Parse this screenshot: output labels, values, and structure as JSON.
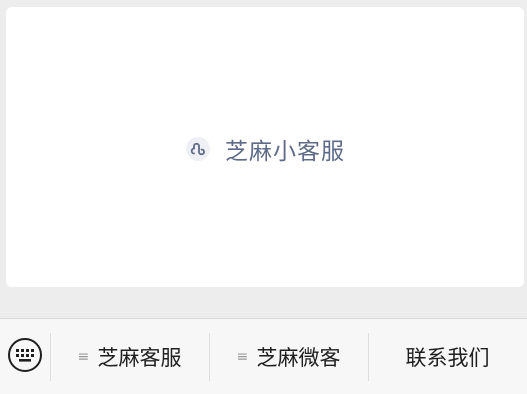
{
  "card": {
    "mini_program_name": "芝麻小客服"
  },
  "menu": {
    "keyboard_icon": "keyboard-icon",
    "items": [
      {
        "label": "芝麻客服",
        "icon": "menu-lines-icon"
      },
      {
        "label": "芝麻微客",
        "icon": "menu-lines-icon"
      },
      {
        "label": "联系我们"
      }
    ]
  },
  "colors": {
    "background": "#ededed",
    "card": "#ffffff",
    "accent": "#5e6b88",
    "menubar": "#f7f7f7"
  }
}
